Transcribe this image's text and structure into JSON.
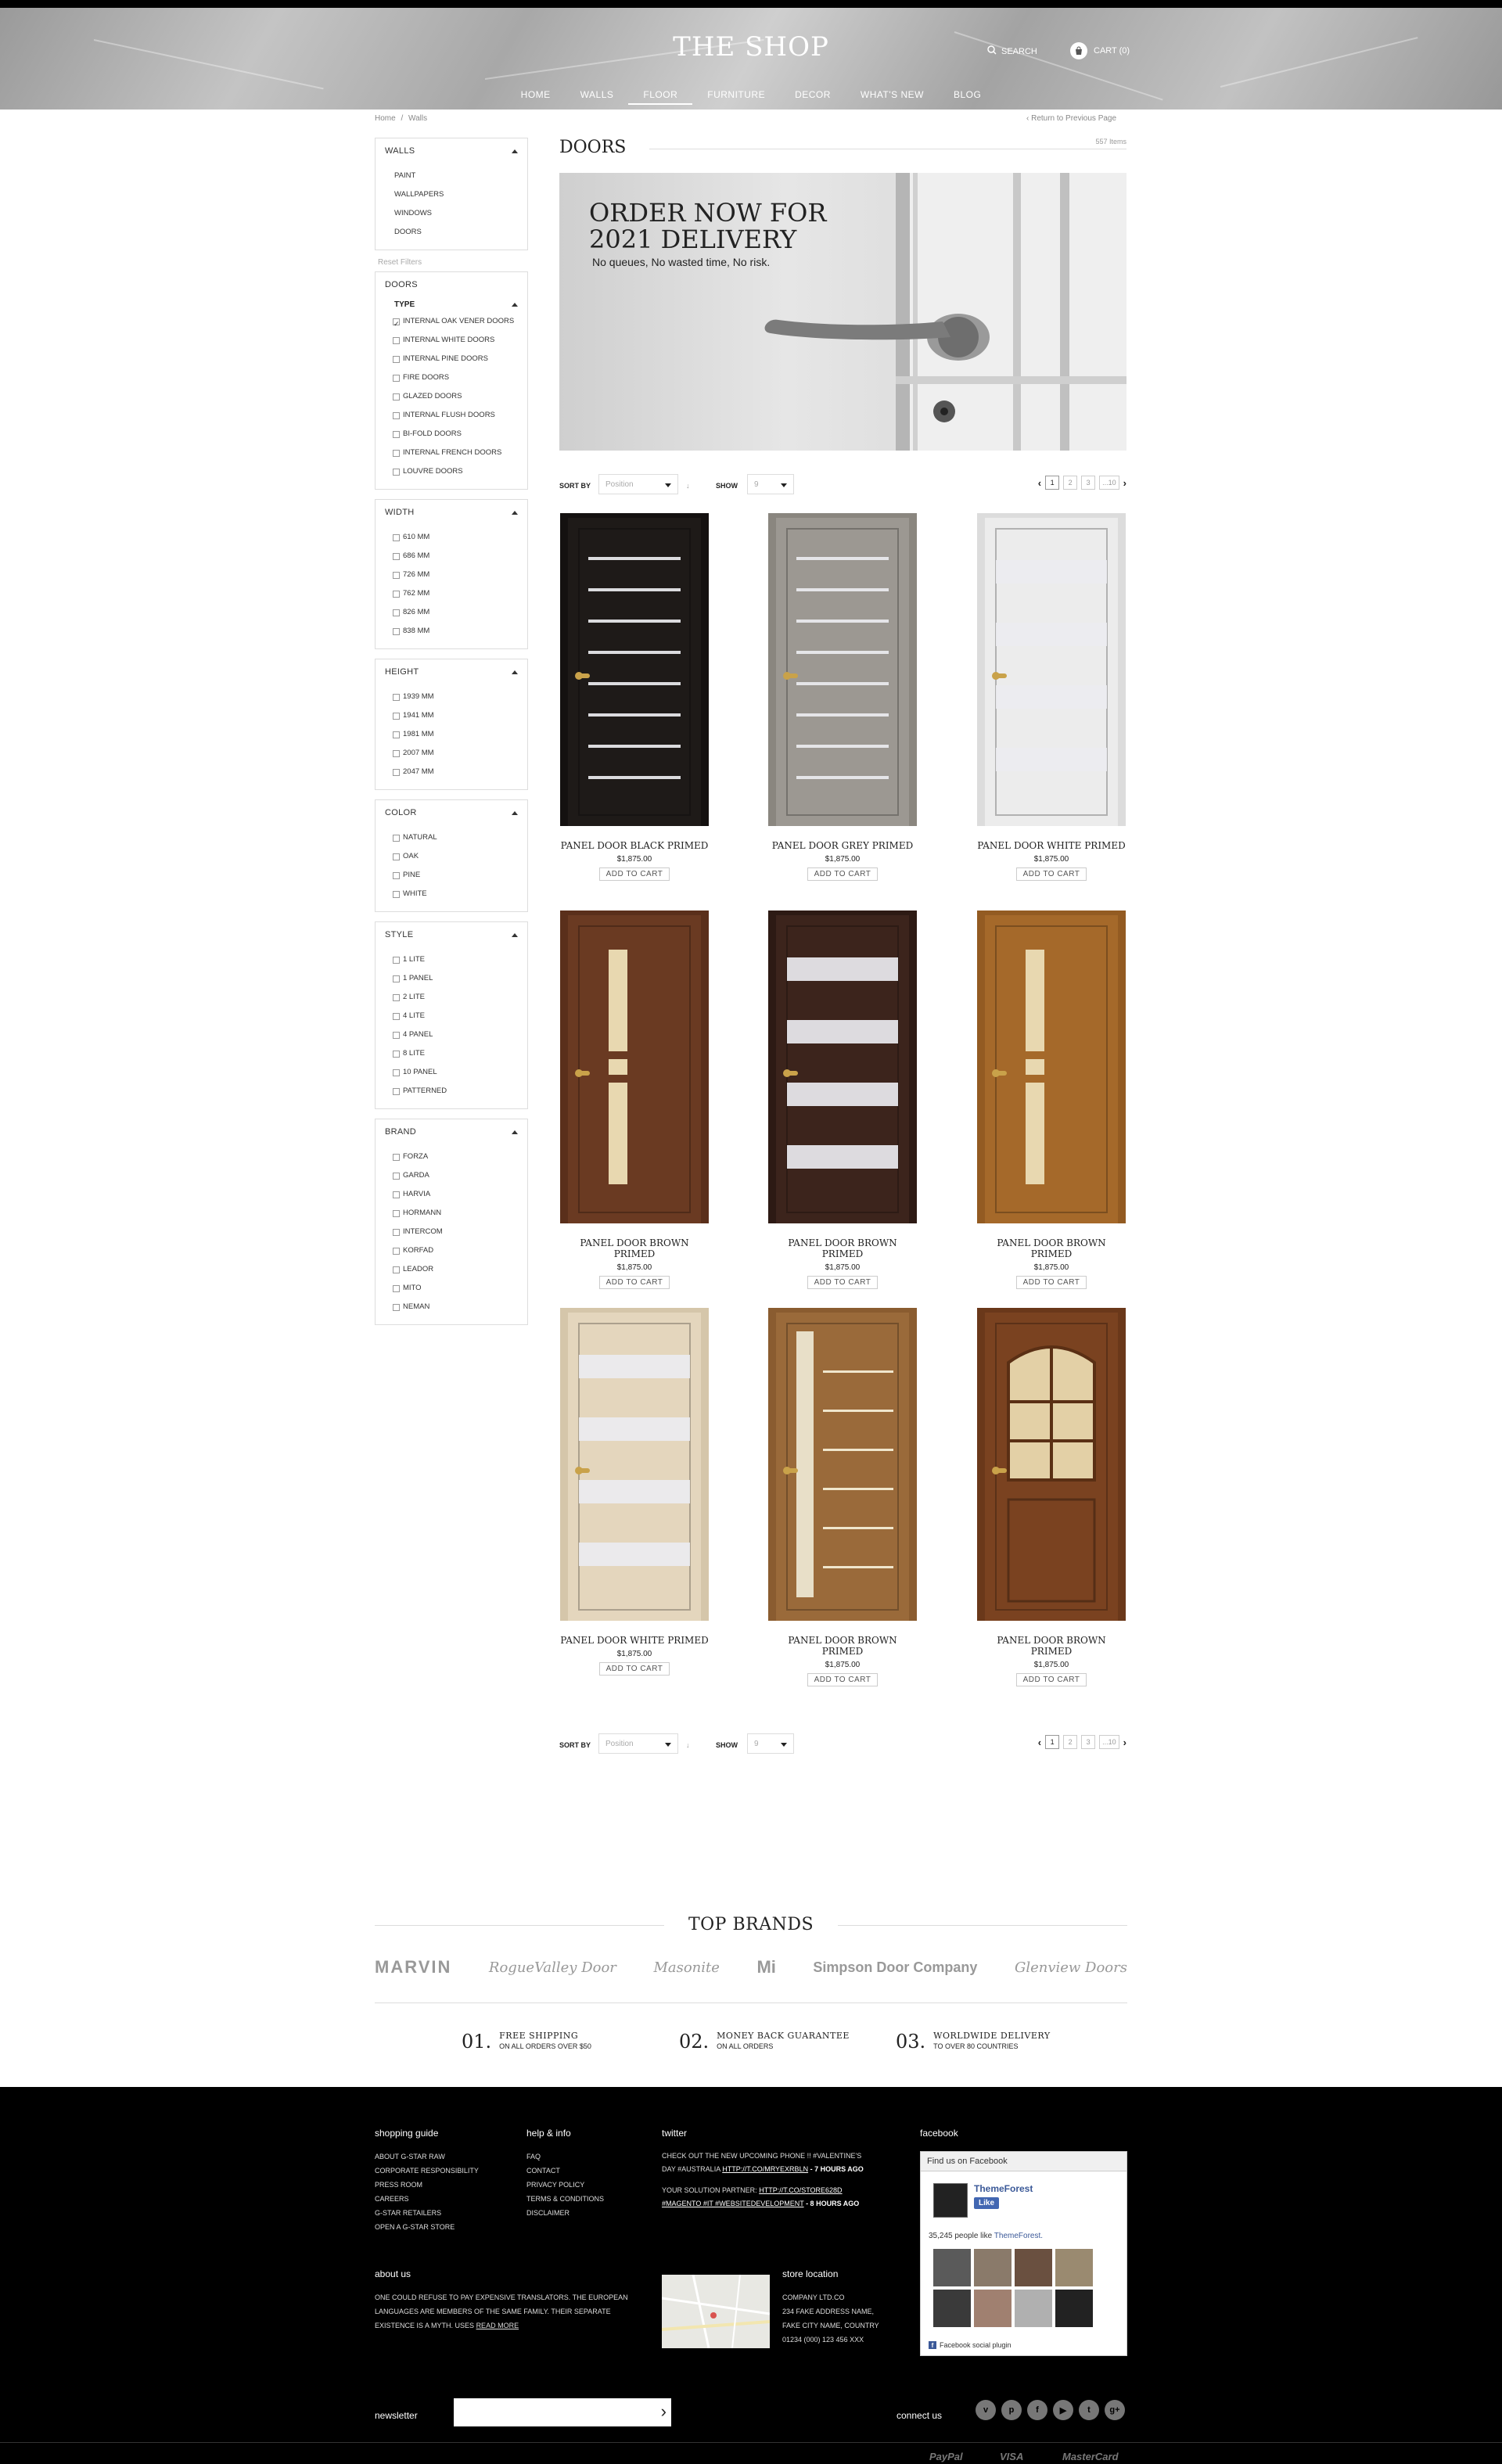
{
  "header": {
    "logo": "THE SHOP",
    "search_label": "SEARCH",
    "cart_label": "CART (0)",
    "nav": [
      {
        "label": "HOME",
        "active": false
      },
      {
        "label": "WALLS",
        "active": false
      },
      {
        "label": "FLOOR",
        "active": true
      },
      {
        "label": "FURNITURE",
        "active": false
      },
      {
        "label": "DECOR",
        "active": false
      },
      {
        "label": "WHAT'S NEW",
        "active": false
      },
      {
        "label": "BLOG",
        "active": false
      }
    ]
  },
  "breadcrumb": {
    "home": "Home",
    "sep": "/",
    "current": "Walls"
  },
  "prev_link": "‹ Return to Previous Page",
  "sidebar": {
    "walls": {
      "title": "WALLS",
      "items": [
        "PAINT",
        "WALLPAPERS",
        "WINDOWS",
        "DOORS"
      ]
    },
    "reset": "Reset Filters",
    "doors": {
      "title": "DOORS",
      "type_title": "TYPE",
      "items": [
        {
          "label": "INTERNAL OAK VENER DOORS",
          "checked": true
        },
        {
          "label": "INTERNAL WHITE DOORS",
          "checked": false
        },
        {
          "label": "INTERNAL PINE DOORS",
          "checked": false
        },
        {
          "label": "FIRE DOORS",
          "checked": false
        },
        {
          "label": "GLAZED DOORS",
          "checked": false
        },
        {
          "label": "INTERNAL FLUSH DOORS",
          "checked": false
        },
        {
          "label": "BI-FOLD DOORS",
          "checked": false
        },
        {
          "label": "INTERNAL FRENCH DOORS",
          "checked": false
        },
        {
          "label": "LOUVRE DOORS",
          "checked": false
        }
      ]
    },
    "width": {
      "title": "WIDTH",
      "items": [
        "610 MM",
        "686 MM",
        "726 MM",
        "762 MM",
        "826 MM",
        "838 MM"
      ]
    },
    "height": {
      "title": "HEIGHT",
      "items": [
        "1939 MM",
        "1941 MM",
        "1981 MM",
        "2007 MM",
        "2047 MM"
      ]
    },
    "color": {
      "title": "COLOR",
      "items": [
        "NATURAL",
        "OAK",
        "PINE",
        "WHITE"
      ]
    },
    "style": {
      "title": "STYLE",
      "items": [
        "1 LITE",
        "1 PANEL",
        "2 LITE",
        "4 LITE",
        "4 PANEL",
        "8 LITE",
        "10 PANEL",
        "PATTERNED"
      ]
    },
    "brand": {
      "title": "BRAND",
      "items": [
        "FORZA",
        "GARDA",
        "HARVIA",
        "HORMANN",
        "INTERCOM",
        "KORFAD",
        "LEADOR",
        "MITO",
        "NEMAN"
      ]
    }
  },
  "main": {
    "title": "DOORS",
    "count": "557 Items",
    "banner": {
      "heading": "ORDER NOW FOR 2021 DELIVERY",
      "sub": "No queues, No wasted time, No risk."
    },
    "toolbar": {
      "sort_label": "SORT BY",
      "sort_value": "Position",
      "sort_dir": "↓",
      "show_label": "SHOW",
      "show_value": "9",
      "pages": [
        "1",
        "2",
        "3",
        "...10"
      ],
      "current_page": "1"
    },
    "products": [
      {
        "name": "PANEL DOOR BLACK PRIMED",
        "price": "$1,875.00",
        "cta": "ADD TO CART",
        "color": "#1e1a18",
        "frame": "#141110",
        "glass": "stripes"
      },
      {
        "name": "PANEL DOOR GREY PRIMED",
        "price": "$1,875.00",
        "cta": "ADD TO CART",
        "color": "#9c9892",
        "frame": "#8a867f",
        "glass": "stripes"
      },
      {
        "name": "PANEL DOOR WHITE PRIMED",
        "price": "$1,875.00",
        "cta": "ADD TO CART",
        "color": "#ececec",
        "frame": "#dcdcdc",
        "glass": "bands"
      },
      {
        "name": "PANEL DOOR BROWN PRIMED",
        "price": "$1,875.00",
        "cta": "ADD TO CART",
        "color": "#6a3a22",
        "frame": "#5a2f1b",
        "glass": "slots"
      },
      {
        "name": "PANEL DOOR BROWN PRIMED",
        "price": "$1,875.00",
        "cta": "ADD TO CART",
        "color": "#3c241c",
        "frame": "#2d1a14",
        "glass": "bands"
      },
      {
        "name": "PANEL DOOR BROWN PRIMED",
        "price": "$1,875.00",
        "cta": "ADD TO CART",
        "color": "#a5692a",
        "frame": "#935b22",
        "glass": "slots"
      },
      {
        "name": "PANEL DOOR WHITE PRIMED",
        "price": "$1,875.00",
        "cta": "ADD TO CART",
        "color": "#e4d6bd",
        "frame": "#d5c6aa",
        "glass": "bands"
      },
      {
        "name": "PANEL DOOR BROWN PRIMED",
        "price": "$1,875.00",
        "cta": "ADD TO CART",
        "color": "#9a6a3a",
        "frame": "#8a5c30",
        "glass": "vertical"
      },
      {
        "name": "PANEL DOOR BROWN PRIMED",
        "price": "$1,875.00",
        "cta": "ADD TO CART",
        "color": "#7a4220",
        "frame": "#6a381a",
        "glass": "arched"
      }
    ]
  },
  "brands": {
    "title": "TOP BRANDS",
    "logos": [
      "MARVIN",
      "RogueValley Door",
      "Masonite",
      "Mi",
      "Simpson Door Company",
      "Glenview Doors"
    ]
  },
  "usps": [
    {
      "num": "01.",
      "title": "FREE SHIPPING",
      "sub": "ON ALL ORDERS OVER $50"
    },
    {
      "num": "02.",
      "title": "MONEY BACK GUARANTEE",
      "sub": "ON ALL ORDERS"
    },
    {
      "num": "03.",
      "title": "WORLDWIDE DELIVERY",
      "sub": "TO OVER 80 COUNTRIES"
    }
  ],
  "footer": {
    "shopping": {
      "title": "shopping guide",
      "items": [
        "ABOUT G-STAR RAW",
        "CORPORATE RESPONSIBILITY",
        "PRESS ROOM",
        "CAREERS",
        "G-STAR RETAILERS",
        "OPEN A G-STAR STORE"
      ]
    },
    "help": {
      "title": "help & info",
      "items": [
        "FAQ",
        "CONTACT",
        "PRIVACY POLICY",
        "TERMS & CONDITIONS",
        "DISCLAIMER"
      ]
    },
    "twitter": {
      "title": "twitter",
      "t1_text": "CHECK OUT THE NEW UPCOMING PHONE !! #VALENTINE'S DAY #AUSTRALIA",
      "t1_link": "HTTP://T.CO/MRYEXRBLN",
      "t1_time": "- 7 HOURS AGO",
      "t2_text": "YOUR SOLUTION PARTNER:",
      "t2_link": "HTTP://T.CO/STORE628D #MAGENTO #IT #WEBSITEDEVELOPMENT",
      "t2_time": "- 8 HOURS AGO"
    },
    "facebook": {
      "title": "facebook",
      "box_head": "Find us on Facebook",
      "page": "ThemeForest",
      "like": "Like",
      "count_text": "35,245 people like",
      "count_link": "ThemeForest.",
      "plugin": "Facebook social plugin"
    },
    "about": {
      "title": "about us",
      "text": "ONE COULD REFUSE TO PAY EXPENSIVE TRANSLATORS. THE EUROPEAN LANGUAGES ARE MEMBERS OF THE SAME FAMILY. THEIR SEPARATE EXISTENCE IS A MYTH. USES",
      "link": "READ MORE"
    },
    "store": {
      "title": "store location",
      "lines": [
        "COMPANY LTD.CO",
        "234 FAKE ADDRESS NAME,",
        "FAKE CITY NAME, COUNTRY",
        "01234 (000) 123 456 XXX"
      ]
    },
    "newsletter": "newsletter",
    "connect": "connect us",
    "social": [
      "vine-icon",
      "pinterest-icon",
      "facebook-icon",
      "youtube-icon",
      "twitter-icon",
      "google-plus-icon"
    ],
    "payments": [
      "PayPal",
      "VISA",
      "MasterCard"
    ]
  }
}
